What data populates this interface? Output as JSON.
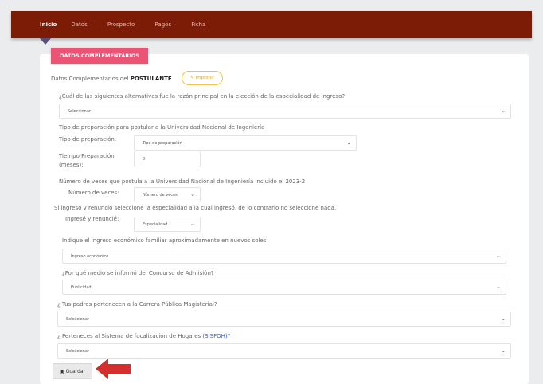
{
  "nav": {
    "items": [
      {
        "label": "Inicio",
        "caret": false
      },
      {
        "label": "Datos",
        "caret": true
      },
      {
        "label": "Prospecto",
        "caret": true
      },
      {
        "label": "Pagos",
        "caret": true
      },
      {
        "label": "Ficha",
        "caret": false
      }
    ],
    "caret_glyph": "⌄"
  },
  "section": {
    "header": "DATOS COMPLEMENTARIOS",
    "intro": "Datos Complementarios del",
    "intro_bold": "POSTULANTE",
    "print_label": "Imprimir"
  },
  "form": {
    "q1": {
      "label": "¿Cuál de las siguientes alternativas fue la razón principal en la elección de la especialidad de ingreso?",
      "value": "Seleccionar"
    },
    "prep_heading": "Tipo de preparación para postular a la Universidad Nacional de Ingeniería",
    "prep_type_label": "Tipo de preparación:",
    "prep_type_value": "Tipo de preparación",
    "prep_time_label_1": "Tiempo Preparación",
    "prep_time_label_2": "(meses):",
    "prep_time_value": "0",
    "times_heading": "Número de veces que postula a la Universidad Nacional de Ingeniería incluido el 2023-2",
    "times_label": "Número de veces:",
    "times_value": "Número de veces",
    "renounce_note": "Si ingresó y renunció seleccione la especialidad a la cual ingresó, de lo contrario no seleccione nada.",
    "renounce_label": "Ingresé y renuncié:",
    "renounce_value": "Especialidad",
    "income_label": "Indique el ingreso económico familiar aproximadamente en nuevos soles",
    "income_value": "Ingreso económico",
    "media_label": "¿Por qué medio se informó del Concurso de Admisión?",
    "media_value": "Publicidad",
    "parents_label": "¿ Tus padres pertenecen a la Carrera Pública Magisterial?",
    "parents_value": "Seleccionar",
    "sisfoh_label": "¿ Perteneces al Sistema de focalización de Hogares",
    "sisfoh_link": "(SISFOH)?",
    "sisfoh_value": "Seleccionar",
    "chevron": "⌄"
  },
  "save_label": "Guardar",
  "colors": {
    "navbar": "#7c1b06",
    "header_badge": "#ec5476",
    "print_border": "#f2c24a",
    "arrow": "#d32f2f",
    "link": "#3b5bdb"
  }
}
